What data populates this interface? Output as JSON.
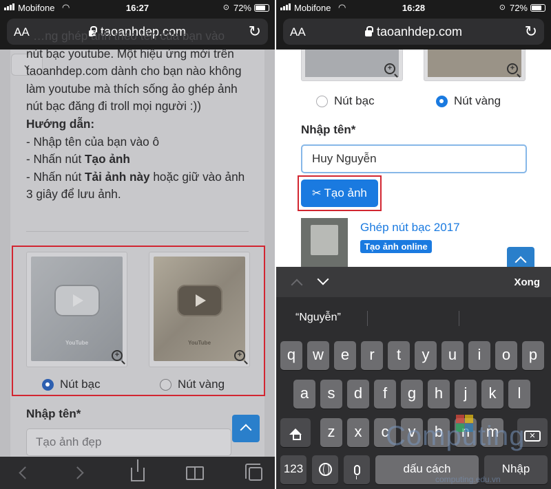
{
  "left": {
    "status": {
      "carrier": "Mobifone",
      "time": "16:27",
      "battery": "72%"
    },
    "url_bar": {
      "text_size_label": "AA",
      "domain": "taoanhdep.com"
    },
    "article": {
      "line1": "…ng ghép ảnh theo tên của bạn vào",
      "line2": "nút bạc youtube. Một hiệu ứng mới trên",
      "line3": "taoanhdep.com dành cho bạn nào không",
      "line4": "làm youtube mà thích sống ảo ghép ảnh",
      "line5": "nút bạc đăng đi troll mọi người :))",
      "guide_heading": "Hướng dẫn:",
      "step1": "- Nhập tên của bạn vào ô",
      "step2_prefix": "- Nhấn nút ",
      "step2_bold": "Tạo ảnh",
      "step3_prefix": "- Nhấn nút ",
      "step3_bold": "Tải ảnh này",
      "step3_suffix": " hoặc giữ vào ảnh",
      "step3_line2": "3 giây để lưu ảnh."
    },
    "options": [
      {
        "label": "Nút bạc",
        "selected": true
      },
      {
        "label": "Nút vàng",
        "selected": false
      }
    ],
    "plaque_brand": "YouTube",
    "name_label": "Nhập tên*",
    "name_placeholder": "Tạo ảnh đẹp"
  },
  "right": {
    "status": {
      "carrier": "Mobifone",
      "time": "16:28",
      "battery": "72%"
    },
    "url_bar": {
      "text_size_label": "AA",
      "domain": "taoanhdep.com"
    },
    "options": [
      {
        "label": "Nút bạc",
        "selected": false
      },
      {
        "label": "Nút vàng",
        "selected": true
      }
    ],
    "name_label": "Nhập tên*",
    "name_value": "Huy Nguyễn",
    "create_button": "Tạo ảnh",
    "related": {
      "title": "Ghép nút bạc 2017",
      "badge": "Tạo ảnh online"
    },
    "keyboard": {
      "done": "Xong",
      "suggestion": "“Nguyễn”",
      "row1": [
        "q",
        "w",
        "e",
        "r",
        "t",
        "y",
        "u",
        "i",
        "o",
        "p"
      ],
      "row2": [
        "a",
        "s",
        "d",
        "f",
        "g",
        "h",
        "j",
        "k",
        "l"
      ],
      "row3": [
        "z",
        "x",
        "c",
        "v",
        "b",
        "n",
        "m"
      ],
      "numbers": "123",
      "space": "dấu cách",
      "return": "Nhập"
    }
  },
  "watermark": {
    "text": "Computing",
    "sub": "computing.edu.vn"
  },
  "colors": {
    "accent_blue": "#1a7ae0",
    "highlight_red": "#d22530",
    "keyboard_bg": "#2d2d2f"
  }
}
